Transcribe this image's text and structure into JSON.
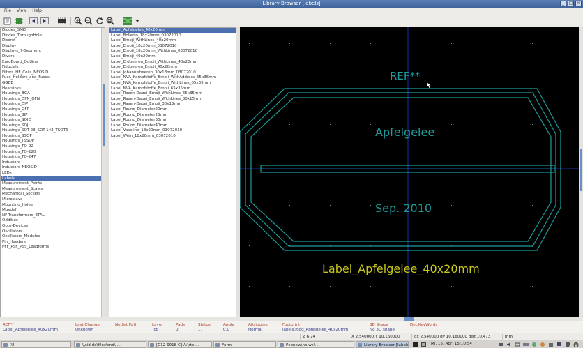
{
  "window": {
    "title": "Library Browser [labels]"
  },
  "menu": [
    "File",
    "View",
    "Help"
  ],
  "libraries": {
    "items": [
      "Diodes_SMD",
      "Diodes_ThroughHole",
      "Discret",
      "Display",
      "Displays_7-Segment",
      "Divers",
      "EuroBoard_Outline",
      "Fiducials",
      "Filters_HF_Coils_NEOSID",
      "Fuse_Holders_and_Fuses",
      "GGBE",
      "Heatsinks",
      "Housings_BGA",
      "Housings_DFN_QFN",
      "Housings_DIP",
      "Housings_QFP",
      "Housings_SIP",
      "Housings_SOIC",
      "Housings_SOJ",
      "Housings_SOT-23_SOT-143_TSOT6",
      "Housings_SSOP",
      "Housings_TSSOP",
      "Housings_TO-92",
      "Housings_TO-220",
      "Housings_TO-247",
      "Inductors",
      "Inductors_NEOSID",
      "LEDs",
      "Labels",
      "Measurement_Points",
      "Measurement_Scales",
      "Mechanical_Sockets",
      "Microwave",
      "Mounting_Holes",
      "Muxdef",
      "NF-Transformers_ETAL",
      "Oddities",
      "Opto-Devices",
      "Oscillators",
      "Oscillators_Modules",
      "Pin_Headers",
      "PFF_PSF_PSS_Leadforms"
    ],
    "selected_index": 28
  },
  "footprints": {
    "items": [
      "Label_Apfelgelee_40x20mm",
      "Label_Bolletto_18x20mm_03072010",
      "Label_Emoji_WithLines_40x20mm",
      "Label_Emoji_18x20mm_03072010",
      "Label_Emoji_18x20mm_WithLines_03072010",
      "Label_Emoji_40x20mm",
      "Label_Erdbeeren_Emoji_WithLines_40x20mm",
      "Label_Erdbeeren_Emoji_40x20mm",
      "Label_Johannisbeeren_30x18mm_03072010",
      "Label_NVA_Kampfstoffe_Emoji_WithAddress_65x35mm",
      "Label_NVA_Kampfstoffe_Emoji_WithLines_65x35mm",
      "Label_NVA_Kampfstoffe_Emoji_65x35mm",
      "Label_Rasen-Dabei_Emoji_WithLines_65x35mm",
      "Label_Rasen-Dabei_Emoji_WithLines_30x15mm",
      "Label_Rasen-Dabei_Emoji_30x15mm",
      "Label_Round_Diameter20mm",
      "Label_Round_Diameter25mm",
      "Label_Round_Diameter30mm",
      "Label_Round_Diameter40mm",
      "Label_Vaseline_18x20mm_03072010",
      "Label_Wein_18x20mm_03072010"
    ],
    "selected_index": 0
  },
  "canvas": {
    "reference": "REF**",
    "text_top": "Apfelgelee",
    "text_bottom": "Sep. 2010",
    "value": "Label_Apfelgelee_40x20mm"
  },
  "message_panel": [
    {
      "label": "REF**",
      "value": "Label_Apfelgelee_40x20mm"
    },
    {
      "label": "Last Change",
      "value": "Unknown"
    },
    {
      "label": "Netlist Path",
      "value": ""
    },
    {
      "label": "Layer",
      "value": "Top"
    },
    {
      "label": "Pads",
      "value": "0"
    },
    {
      "label": "Status",
      "value": "..."
    },
    {
      "label": "Angle",
      "value": "0.0"
    },
    {
      "label": "Attributes",
      "value": "Normal"
    },
    {
      "label": "Footprint",
      "value": "labels.mod_Apfelgelee_40x20mm"
    },
    {
      "label": "3D Shape",
      "value": "No 3D shape"
    },
    {
      "label": "Doc",
      "value": ""
    },
    {
      "label": "KeyWords",
      "value": ""
    }
  ],
  "status": {
    "zoom": "Z 6.74",
    "xy": "X 2.540000  Y 10.160000",
    "dxdy": "dx 2.540000  dy 10.160000  dist 10.473",
    "units": "mm"
  },
  "taskbar": {
    "start": "[U]",
    "tasks": [
      {
        "label": "\\\\sid.de\\files\\snd\\ ...",
        "active": false
      },
      {
        "label": "[C12 6918 C] A:\\rte ...",
        "active": false
      },
      {
        "label": "Form",
        "active": false
      },
      {
        "label": "Pcbnew\\ne.ws\\...",
        "active": false
      },
      {
        "label": "Library Browser [labels]",
        "active": true
      }
    ],
    "clock": "Mi, 15. Apr, 15:10:54"
  },
  "colors": {
    "canvas_bg": "#000000",
    "outline": "#1e9c9c",
    "ref_text": "#1e9c9c",
    "value_text": "#c8c81a",
    "axis": "#1a2fa8",
    "selection": "#4c6fb0"
  },
  "icons": [
    "new-library-icon",
    "footprint-icon",
    "prev-icon",
    "next-icon",
    "3d-icon",
    "zoom-in-icon",
    "zoom-out-icon",
    "redraw-icon",
    "zoom-fit-icon",
    "export-icon",
    "dropdown-icon"
  ]
}
